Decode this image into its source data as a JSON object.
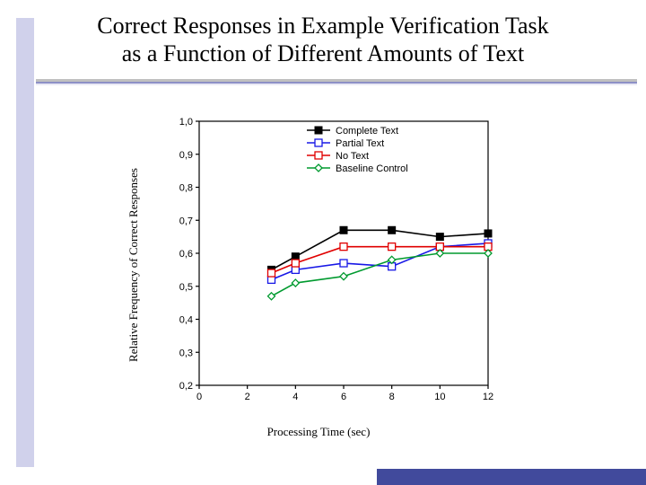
{
  "title": {
    "line1": "Correct Responses in Example Verification Task",
    "line2": "as a Function of Different Amounts of Text"
  },
  "chart_data": {
    "type": "line",
    "xlabel": "Processing Time (sec)",
    "ylabel": "Relative Frequency of Correct Responses",
    "xlim": [
      0,
      12
    ],
    "ylim": [
      0.2,
      1.0
    ],
    "xticks": [
      0,
      2,
      4,
      6,
      8,
      10,
      12
    ],
    "yticks": [
      0.2,
      0.3,
      0.4,
      0.5,
      0.6,
      0.7,
      0.8,
      0.9,
      1.0
    ],
    "ytick_labels": [
      "0,2",
      "0,3",
      "0,4",
      "0,5",
      "0,6",
      "0,7",
      "0,8",
      "0,9",
      "1,0"
    ],
    "x": [
      3,
      4,
      6,
      8,
      10,
      12
    ],
    "series": [
      {
        "name": "Complete Text",
        "color": "#000000",
        "marker": "square-filled",
        "values": [
          0.55,
          0.59,
          0.67,
          0.67,
          0.65,
          0.66
        ]
      },
      {
        "name": "Partial Text",
        "color": "#1818e6",
        "marker": "square-open",
        "values": [
          0.52,
          0.55,
          0.57,
          0.56,
          0.62,
          0.63
        ]
      },
      {
        "name": "No Text",
        "color": "#e00000",
        "marker": "square-open",
        "values": [
          0.54,
          0.57,
          0.62,
          0.62,
          0.62,
          0.62
        ]
      },
      {
        "name": "Baseline Control",
        "color": "#009a2f",
        "marker": "diamond-open",
        "values": [
          0.47,
          0.51,
          0.53,
          0.58,
          0.6,
          0.6
        ]
      }
    ],
    "legend_position": "top-right"
  }
}
